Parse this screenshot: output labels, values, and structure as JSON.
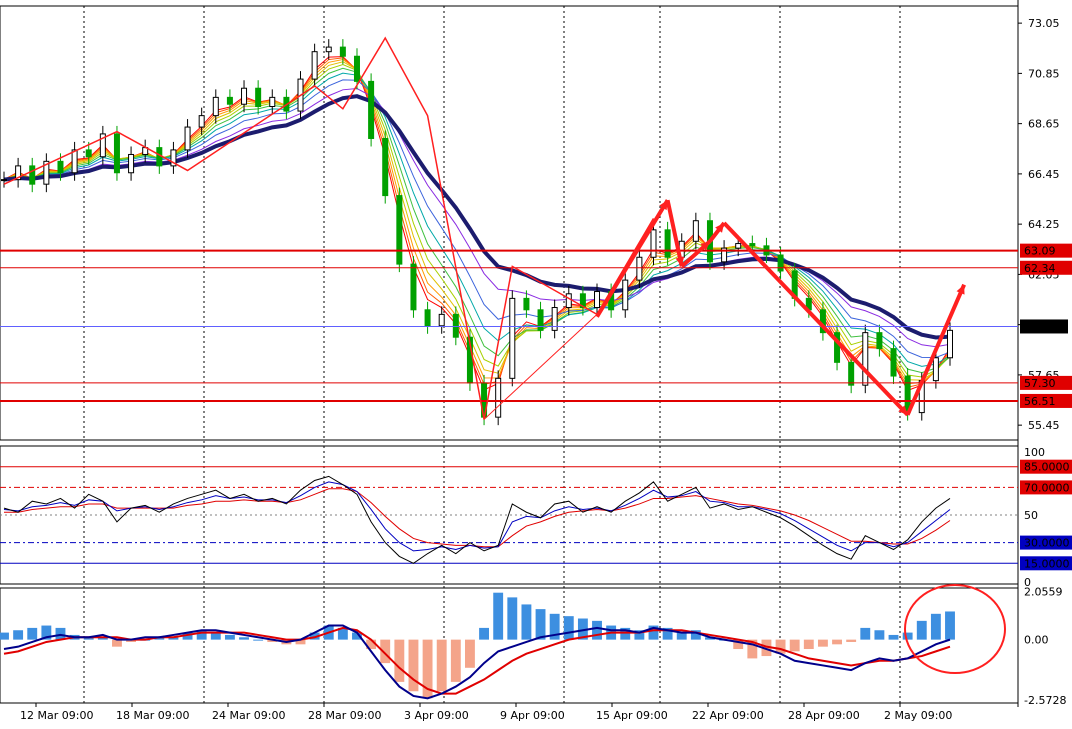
{
  "chart_data": {
    "type": "line",
    "price_panel": {
      "ylim": [
        54.8,
        73.8
      ],
      "tick_labels": [
        "73.05",
        "70.85",
        "68.65",
        "66.45",
        "64.25",
        "62.05",
        "59.85",
        "57.65",
        "55.45"
      ],
      "tick_values": [
        73.05,
        70.85,
        68.65,
        66.45,
        64.25,
        62.05,
        59.85,
        57.65,
        55.45
      ],
      "levels": [
        {
          "label": "63.09",
          "value": 63.09,
          "color": "#e00000"
        },
        {
          "label": "62.34",
          "value": 62.34,
          "color": "#e00000"
        },
        {
          "label": "57.30",
          "value": 57.3,
          "color": "#e00000"
        },
        {
          "label": "56.51",
          "value": 56.51,
          "color": "#e00000"
        }
      ],
      "current": {
        "label": "59.77",
        "value": 59.77
      },
      "close": [
        66.2,
        66.8,
        66.0,
        67.0,
        66.5,
        67.5,
        67.2,
        68.2,
        66.5,
        67.3,
        67.6,
        66.8,
        67.5,
        68.5,
        69.0,
        69.8,
        69.5,
        70.2,
        69.4,
        69.8,
        69.2,
        70.6,
        71.8,
        72.0,
        71.6,
        70.5,
        68.0,
        65.5,
        62.5,
        60.5,
        59.8,
        60.3,
        59.3,
        57.3,
        55.8,
        57.5,
        61.0,
        60.5,
        59.6,
        60.6,
        61.2,
        60.6,
        61.3,
        60.5,
        61.8,
        62.8,
        64.0,
        62.8,
        63.5,
        64.4,
        62.6,
        63.2,
        63.4,
        63.3,
        62.9,
        62.2,
        61.0,
        60.5,
        59.5,
        58.2,
        57.2,
        59.5,
        58.8,
        57.6,
        56.0,
        57.4,
        58.4,
        59.6
      ]
    },
    "rsi_panel": {
      "ylim": [
        0,
        100
      ],
      "tick_labels": [
        "100",
        "85.0000",
        "70.0000",
        "50",
        "30.0000",
        "15.0000",
        "0"
      ],
      "tick_values": [
        100,
        85,
        70,
        50,
        30,
        15,
        0
      ],
      "close": [
        55,
        52,
        60,
        58,
        62,
        55,
        65,
        60,
        45,
        55,
        57,
        52,
        58,
        62,
        65,
        68,
        62,
        65,
        60,
        62,
        58,
        68,
        75,
        78,
        72,
        65,
        45,
        30,
        20,
        15,
        22,
        28,
        22,
        30,
        24,
        28,
        58,
        52,
        48,
        58,
        60,
        52,
        56,
        52,
        60,
        66,
        74,
        60,
        65,
        70,
        55,
        58,
        54,
        56,
        52,
        48,
        42,
        35,
        28,
        22,
        18,
        35,
        30,
        25,
        32,
        45,
        55,
        62
      ],
      "ma": [
        54,
        53,
        56,
        57,
        59,
        57,
        61,
        60,
        53,
        55,
        56,
        54,
        56,
        59,
        61,
        64,
        62,
        63,
        61,
        61,
        59,
        64,
        70,
        74,
        72,
        67,
        54,
        40,
        30,
        24,
        25,
        27,
        25,
        28,
        26,
        27,
        45,
        49,
        48,
        53,
        56,
        54,
        55,
        53,
        57,
        62,
        68,
        63,
        64,
        67,
        60,
        59,
        56,
        56,
        54,
        51,
        46,
        40,
        34,
        28,
        24,
        30,
        30,
        27,
        30,
        38,
        46,
        54
      ],
      "signal": [
        52,
        52,
        54,
        55,
        56,
        56,
        58,
        58,
        55,
        55,
        55,
        55,
        55,
        57,
        58,
        60,
        60,
        61,
        60,
        60,
        59,
        61,
        65,
        69,
        69,
        67,
        59,
        49,
        40,
        33,
        30,
        29,
        28,
        28,
        27,
        27,
        35,
        42,
        45,
        49,
        52,
        53,
        54,
        53,
        55,
        58,
        62,
        62,
        63,
        64,
        62,
        60,
        58,
        57,
        55,
        53,
        50,
        46,
        41,
        36,
        31,
        31,
        30,
        29,
        29,
        33,
        39,
        46
      ]
    },
    "macd_panel": {
      "ylim": [
        -2.7,
        2.2
      ],
      "tick_labels": [
        "2.0559",
        "0.00",
        "-2.5728"
      ],
      "tick_values": [
        2.0559,
        0.0,
        -2.5728
      ],
      "histogram": [
        0.3,
        0.4,
        0.5,
        0.6,
        0.5,
        0.2,
        0.1,
        0.1,
        -0.3,
        -0.1,
        0.0,
        0.1,
        0.1,
        0.3,
        0.4,
        0.3,
        0.2,
        0.1,
        0.0,
        -0.1,
        -0.2,
        -0.2,
        0.3,
        0.6,
        0.5,
        0.3,
        -0.4,
        -1.0,
        -1.8,
        -2.2,
        -2.5,
        -2.2,
        -1.8,
        -1.2,
        0.5,
        2.0,
        1.8,
        1.5,
        1.3,
        1.1,
        1.0,
        0.9,
        0.8,
        0.6,
        0.5,
        0.4,
        0.6,
        0.5,
        0.3,
        0.4,
        0.1,
        0.0,
        -0.4,
        -0.8,
        -0.7,
        -0.6,
        -0.5,
        -0.4,
        -0.3,
        -0.2,
        -0.1,
        0.5,
        0.4,
        0.2,
        0.3,
        0.8,
        1.1,
        1.2
      ],
      "macd": [
        -0.4,
        -0.3,
        -0.1,
        0.1,
        0.2,
        0.1,
        0.1,
        0.2,
        0.0,
        0.0,
        0.1,
        0.1,
        0.2,
        0.3,
        0.4,
        0.4,
        0.3,
        0.2,
        0.1,
        0.0,
        -0.1,
        0.0,
        0.3,
        0.6,
        0.6,
        0.3,
        -0.5,
        -1.3,
        -2.0,
        -2.4,
        -2.5,
        -2.3,
        -2.0,
        -1.6,
        -1.0,
        -0.5,
        -0.3,
        -0.1,
        0.1,
        0.2,
        0.3,
        0.4,
        0.5,
        0.4,
        0.4,
        0.3,
        0.5,
        0.4,
        0.3,
        0.3,
        0.1,
        0.0,
        -0.1,
        -0.2,
        -0.4,
        -0.6,
        -0.9,
        -1.0,
        -1.1,
        -1.2,
        -1.3,
        -1.0,
        -0.8,
        -0.9,
        -0.8,
        -0.5,
        -0.2,
        0.0
      ],
      "signal": [
        -0.6,
        -0.5,
        -0.3,
        -0.1,
        0.0,
        0.1,
        0.1,
        0.1,
        0.1,
        0.0,
        0.0,
        0.1,
        0.1,
        0.2,
        0.3,
        0.3,
        0.3,
        0.3,
        0.2,
        0.1,
        0.0,
        0.0,
        0.1,
        0.3,
        0.5,
        0.4,
        0.0,
        -0.6,
        -1.2,
        -1.7,
        -2.1,
        -2.3,
        -2.3,
        -2.0,
        -1.7,
        -1.3,
        -0.9,
        -0.6,
        -0.4,
        -0.2,
        0.0,
        0.1,
        0.2,
        0.3,
        0.3,
        0.3,
        0.4,
        0.4,
        0.4,
        0.3,
        0.2,
        0.1,
        0.0,
        -0.1,
        -0.3,
        -0.4,
        -0.6,
        -0.8,
        -0.9,
        -1.0,
        -1.1,
        -1.0,
        -0.9,
        -0.9,
        -0.8,
        -0.7,
        -0.5,
        -0.3
      ]
    },
    "x_labels": [
      "12 Mar 09:00",
      "18 Mar 09:00",
      "24 Mar 09:00",
      "28 Mar 09:00",
      "3 Apr 09:00",
      "9 Apr 09:00",
      "15 Apr 09:00",
      "22 Apr 09:00",
      "28 Apr 09:00",
      "2 May 09:00"
    ],
    "colors": {
      "background": "#ffffff",
      "plot": "#ffffff",
      "candle_up": "#000000",
      "candle_down": "#00a000",
      "level": "#e00000",
      "current_line": "#6060ff",
      "slow_ma": "#1c1c6e",
      "rsi": "#000000",
      "rsi_ma": "#0000c0",
      "rsi_signal": "#e00000",
      "macd_pos": "#3d8fe0",
      "macd_neg": "#f4a48a",
      "macd_line": "#00008b",
      "macd_signal": "#e00000",
      "annotation": "#ff2020"
    }
  }
}
